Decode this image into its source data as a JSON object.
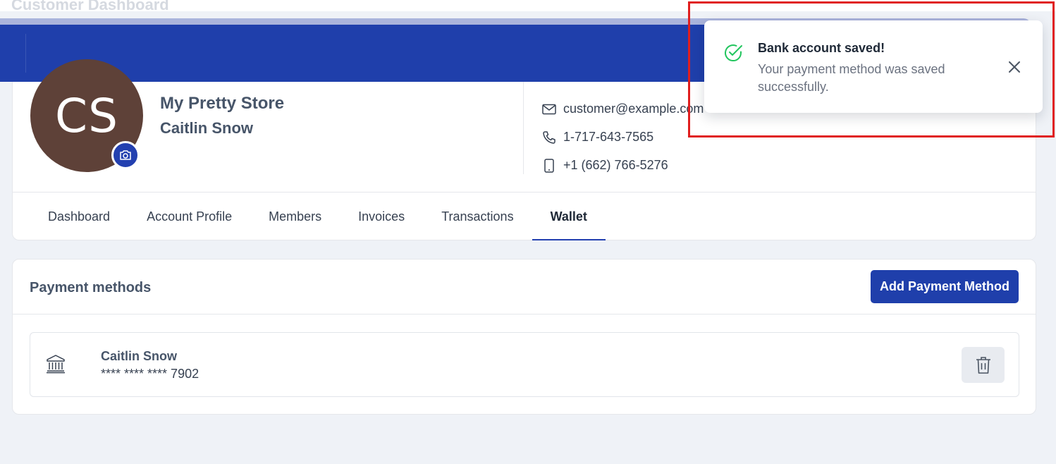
{
  "page": {
    "title": "Customer Dashboard"
  },
  "profile": {
    "initials": "CS",
    "store_name": "My Pretty Store",
    "owner_name": "Caitlin Snow",
    "contacts": {
      "email": "customer@example.com",
      "phone": "1-717-643-7565",
      "mobile": "+1 (662) 766-5276"
    }
  },
  "tabs": [
    {
      "label": "Dashboard",
      "active": false
    },
    {
      "label": "Account Profile",
      "active": false
    },
    {
      "label": "Members",
      "active": false
    },
    {
      "label": "Invoices",
      "active": false
    },
    {
      "label": "Transactions",
      "active": false
    },
    {
      "label": "Wallet",
      "active": true
    }
  ],
  "payment_methods": {
    "title": "Payment methods",
    "add_button_label": "Add Payment Method",
    "items": [
      {
        "name": "Caitlin Snow",
        "number": "**** **** **** 7902",
        "icon": "bank-icon"
      }
    ]
  },
  "toast": {
    "title": "Bank account saved!",
    "message": "Your payment method was saved successfully.",
    "icon": "check-circle-icon"
  },
  "colors": {
    "primary": "#1f3fab",
    "avatar_bg": "#5e4138",
    "success": "#22c55e",
    "highlight": "#e01e1e"
  }
}
